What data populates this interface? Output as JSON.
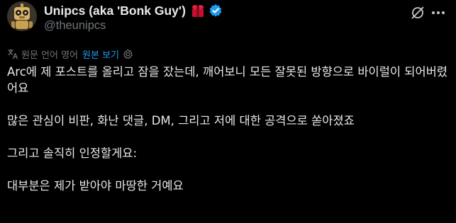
{
  "post": {
    "display_name": "Unipcs (aka 'Bonk Guy')",
    "handle": "@theunipcs",
    "translation_note": "원문 언어 영어",
    "show_original_label": "원본 보기",
    "paragraphs": [
      "Arc에 제 포스트를 올리고 잠을 잤는데, 깨어보니 모든 잘못된 방향으로 바이럴이 되어버렸어요",
      "많은 관심이 비판, 화난 댓글, DM, 그리고 저에 대한 공격으로 쏟아졌죠",
      "그리고 솔직히 인정할게요:",
      "대부분은 제가 받아야 마땅한 거예요"
    ]
  },
  "icons": {
    "avatar": "robot-dog-avatar",
    "name_emoji": "red-gift-bow-icon",
    "verified": "verified-badge-icon",
    "grok": "grok-icon",
    "more": "more-options-icon",
    "translate": "translate-icon",
    "settings": "settings-gear-icon"
  },
  "colors": {
    "background": "#000000",
    "text": "#e7e9ea",
    "secondary": "#71767b",
    "accent": "#1d9bf0",
    "emoji_red": "#c8102e"
  }
}
